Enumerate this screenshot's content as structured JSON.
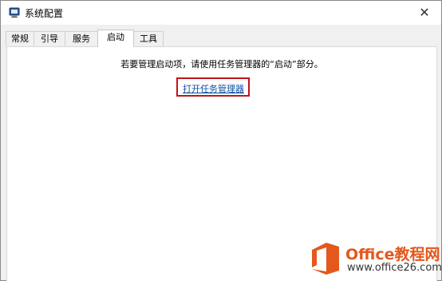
{
  "window": {
    "title": "系统配置",
    "icon": "system-config-icon",
    "close_glyph": "✕"
  },
  "tabs": [
    {
      "label": "常规",
      "active": false
    },
    {
      "label": "引导",
      "active": false
    },
    {
      "label": "服务",
      "active": false
    },
    {
      "label": "启动",
      "active": true
    },
    {
      "label": "工具",
      "active": false
    }
  ],
  "startup": {
    "message": "若要管理启动项，请使用任务管理器的“启动”部分。",
    "open_task_manager_label": "打开任务管理器",
    "highlight_color": "#c0141b",
    "link_color": "#0b4ea2"
  },
  "watermark": {
    "brand_prefix": "Office",
    "brand_suffix": "教程网",
    "url": "www.office26.com",
    "accent_color": "#e4571d"
  }
}
